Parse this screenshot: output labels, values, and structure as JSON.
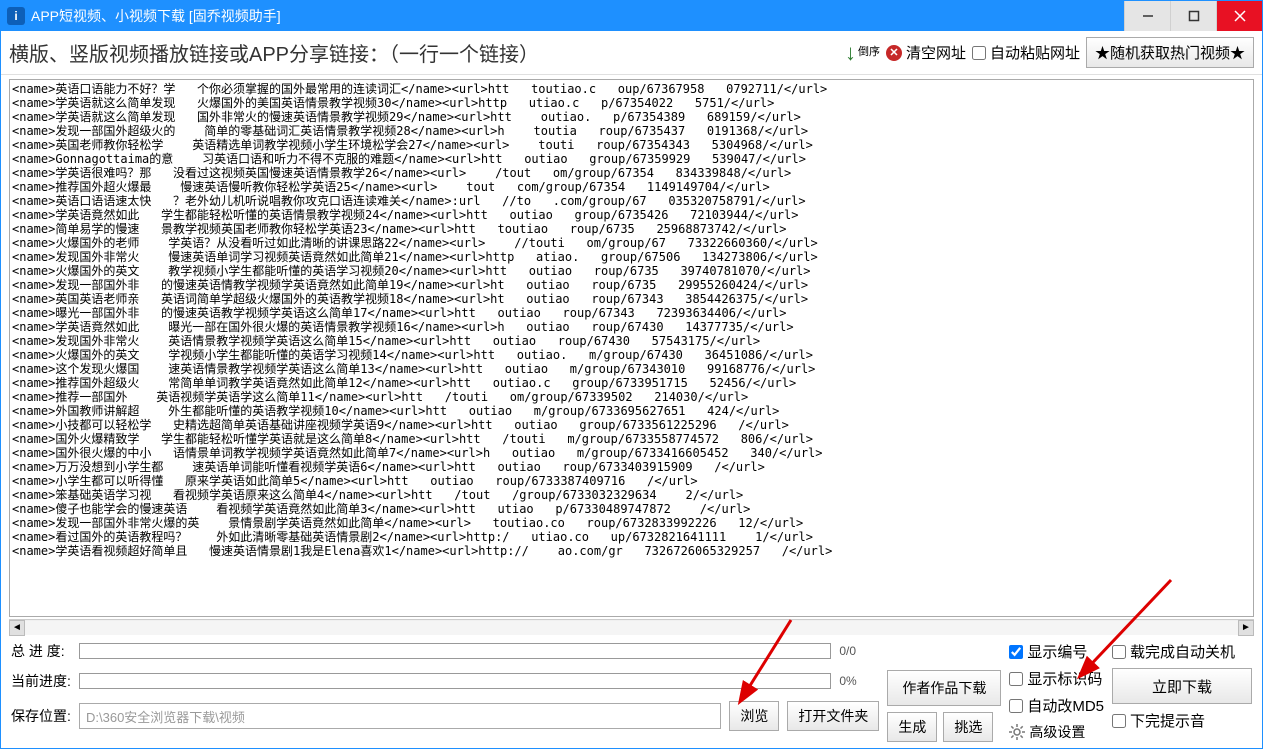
{
  "titlebar": {
    "icon_letter": "i",
    "title": "APP短视频、小视频下载 [固乔视频助手]"
  },
  "toolbar": {
    "instruction": "横版、竖版视频播放链接或APP分享链接：（一行一个链接）",
    "sort_label": "倒序",
    "clear_label": "清空网址",
    "auto_paste_label": "自动粘贴网址",
    "random_btn": "★随机获取热门视频★"
  },
  "textarea_content": "<name>英语口语能力不好？学   个你必须掌握的国外最常用的连读词汇</name><url>htt   toutiao.c   oup/67367958   0792711/</url>\n<name>学英语就这么简单发现   火爆国外的美国英语情景教学视频30</name><url>http   utiao.c   p/67354022   5751/</url>\n<name>学英语就这么简单发现   国外非常火的慢速英语情景教学视频29</name><url>htt    outiao.   p/67354389   689159/</url>\n<name>发现一部国外超级火的    简单的零基础词汇英语情景教学视频28</name><url>h    toutia   roup/6735437   0191368/</url>\n<name>英国老师教你轻松学    英语精选单词教学视频小学生环境松学会27</name><url>    touti   roup/67354343   5304968/</url>\n<name>Gonnagottaima的意    习英语口语和听力不得不克服的难题</name><url>htt   outiao   group/67359929   539047/</url>\n<name>学英语很难吗？那   没看过这视频英国慢速英语情景教学26</name><url>    /tout   om/group/67354   834339848/</url>\n<name>推荐国外超火爆最    慢速英语慢听教你轻松学英语25</name><url>    tout   com/group/67354   1149149704/</url>\n<name>英语口语语速太快   ？老外幼儿机听说唱教你攻克口语连读难关</name>:url   //to   .com/group/67   035320758791/</url>\n<name>学英语竟然如此   学生都能轻松听懂的英语情景教学视频24</name><url>htt   outiao   group/6735426   72103944/</url>\n<name>简单易学的慢速   景教学视频英国老师教你轻松学英语23</name><url>htt   toutiao   roup/6735   25968873742/</url>\n<name>火爆国外的老师    学英语？从没看听过如此清晰的讲课思路22</name><url>    //touti   om/group/67   73322660360/</url>\n<name>发现国外非常火    慢速英语单词学习视频英语竟然如此简单21</name><url>http   atiao.   group/67506   134273806/</url>\n<name>火爆国外的英文    教学视频小学生都能听懂的英语学习视频20</name><url>htt   outiao   roup/6735   39740781070/</url>\n<name>发现一部国外非   的慢速英语情教学视频学英语竟然如此简单19</name><url>ht   outiao   roup/6735   29955260424/</url>\n<name>英国英语老师亲   英语词简单学超级火爆国外的英语教学视频18</name><url>ht   outiao   roup/67343   3854426375/</url>\n<name>曝光一部国外非   的慢速英语教学视频学英语这么简单17</name><url>htt   outiao   roup/67343   72393634406/</url>\n<name>学英语竟然如此    曝光一部在国外很火爆的英语情景教学视频16</name><url>h   outiao   roup/67430   14377735/</url>\n<name>发现国外非常火    英语情景教学视频学英语这么简单15</name><url>htt   outiao   roup/67430   57543175/</url>\n<name>火爆国外的英文    学视频小学生都能听懂的英语学习视频14</name><url>htt   outiao.   m/group/67430   36451086/</url>\n<name>这个发现火爆国    速英语情景教学视频学英语这么简单13</name><url>htt   outiao   m/group/67343010   99168776/</url>\n<name>推荐国外超级火    常简单单词教学英语竟然如此简单12</name><url>htt   outiao.c   group/6733951715   52456/</url>\n<name>推荐一部国外    英语视频学英语学这么简单11</name><url>htt   /touti   om/group/67339502   214030/</url>\n<name>外国教师讲解超    外生都能听懂的英语教学视频10</name><url>htt   outiao   m/group/6733695627651   424/</url>\n<name>小技都可以轻松学   史精选超简单英语基础讲座视频学英语9</name><url>htt   outiao   group/6733561225296   /</url>\n<name>国外火爆精致学   学生都能轻松听懂学英语就是这么简单8</name><url>htt   /touti   m/group/6733558774572   806/</url>\n<name>国外很火爆的中小   语情景单词教学视频学英语竟然如此简单7</name><url>h   outiao   m/group/6733416605452   340/</url>\n<name>万万没想到小学生都    速英语单词能听懂看视频学英语6</name><url>htt   outiao   roup/6733403915909   /</url>\n<name>小学生都可以听得懂   原来学英语如此简单5</name><url>htt   outiao   roup/6733387409716   /</url>\n<name>笨基础英语学习视   看视频学英语原来这么简单4</name><url>htt   /tout   /group/6733032329634    2/</url>\n<name>傻子也能学会的慢速英语    看视频学英语竟然如此简单3</name><url>htt   utiao   p/67330489747872    /</url>\n<name>发现一部国外非常火爆的英    景情景剧学英语竟然如此简单</name><url>   toutiao.co   roup/6732833992226   12/</url>\n<name>看过国外的英语教程吗？    外如此清晰零基础英语情景剧2</name><url>http:/   utiao.co   up/6732821641111    1/</url>\n<name>学英语看视频超好简单且   慢速英语情景剧1我是Elena喜欢1</name><url>http://    ao.com/gr   7326726065329257   /</url>",
  "progress": {
    "total_label": "总 进 度:",
    "total_text": "0/0",
    "current_label": "当前进度:",
    "current_text": "0%"
  },
  "path": {
    "label": "保存位置:",
    "value": "D:\\360安全浏览器下载\\视频"
  },
  "buttons": {
    "browse": "浏览",
    "open_folder": "打开文件夹",
    "author_works": "作者作品下载",
    "generate": "生成",
    "filter": "挑选",
    "download_now": "立即下载"
  },
  "checks": {
    "show_index": "显示编号",
    "show_id": "显示标识码",
    "auto_md5": "自动改MD5",
    "advanced": "高级设置",
    "auto_shutdown": "载完成自动关机",
    "beep": "下完提示音"
  }
}
